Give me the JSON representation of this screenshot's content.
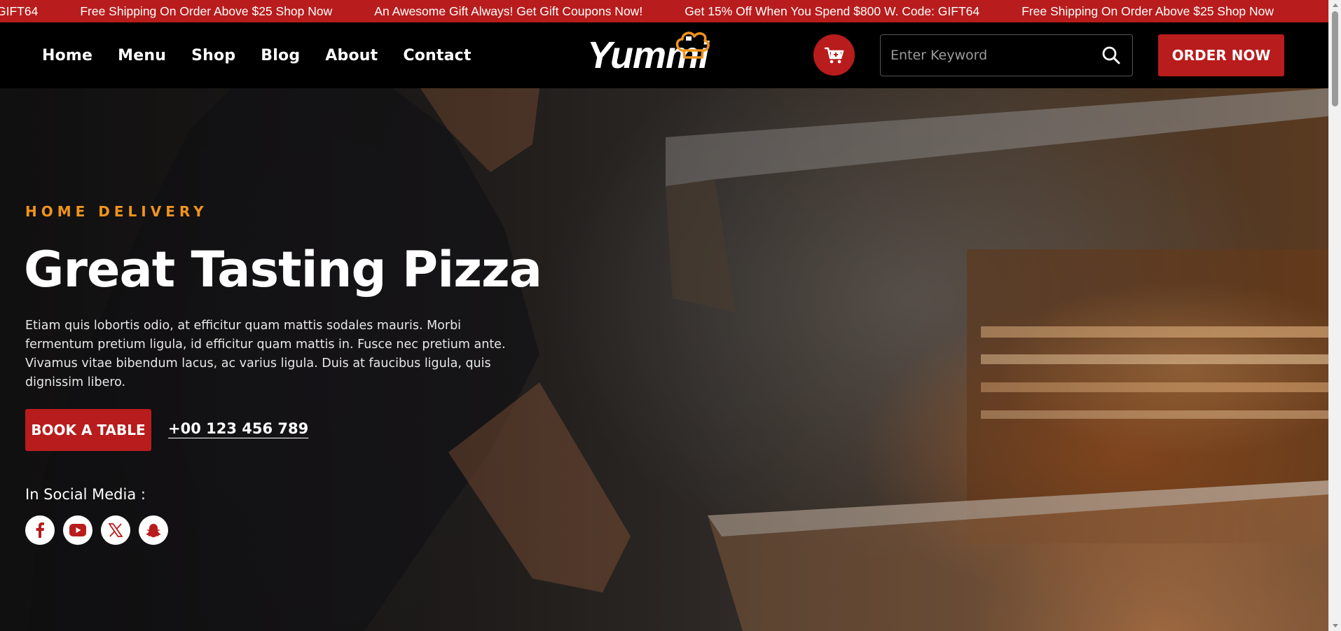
{
  "ticker": {
    "items": [
      "GIFT64",
      "Free Shipping On Order Above $25 Shop Now",
      "An Awesome Gift Always! Get Gift Coupons Now!",
      "Get 15% Off When You Spend $800 W. Code: GIFT64",
      "Free Shipping On Order Above $25 Shop Now"
    ]
  },
  "header": {
    "nav": [
      "Home",
      "Menu",
      "Shop",
      "Blog",
      "About",
      "Contact"
    ],
    "logo": "Yummi",
    "search": {
      "placeholder": "Enter Keyword",
      "value": ""
    },
    "order_label": "ORDER NOW"
  },
  "hero": {
    "eyebrow": "HOME DELIVERY",
    "title": "Great Tasting Pizza",
    "description": "Etiam quis lobortis odio, at efficitur quam mattis sodales mauris. Morbi fermentum pretium ligula, id efficitur quam mattis in. Fusce nec pretium ante. Vivamus vitae bibendum lacus, ac varius ligula. Duis at faucibus ligula, quis dignissim libero.",
    "book_label": "BOOK A TABLE",
    "phone": "+00 123 456 789",
    "social_title": "In Social Media :"
  },
  "icons": [
    "cart-plus-icon",
    "search-icon",
    "chef-hat-icon",
    "facebook-icon",
    "youtube-icon",
    "x-icon",
    "snapchat-icon"
  ],
  "colors": {
    "brand_red": "#b81c1c",
    "accent_orange": "#f0931d",
    "header_bg": "#000000",
    "text_white": "#ffffff"
  }
}
